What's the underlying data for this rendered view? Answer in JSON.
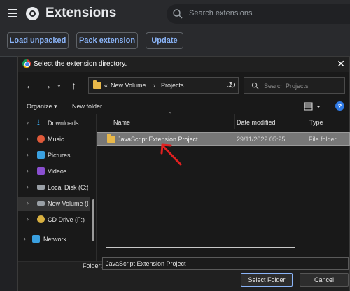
{
  "header": {
    "title": "Extensions",
    "search_placeholder": "Search extensions"
  },
  "toolbar": {
    "load_unpacked": "Load unpacked",
    "pack_extension": "Pack extension",
    "update": "Update"
  },
  "dialog": {
    "title": "Select the extension directory.",
    "close": "✕",
    "breadcrumb": {
      "prefix": "«",
      "parent": "New Volume ...",
      "separator": "›",
      "current": "Projects"
    },
    "search_placeholder": "Search Projects",
    "commands": {
      "organize": "Organize ▾",
      "new_folder": "New folder",
      "help": "?"
    },
    "nav_items": [
      {
        "label": "Downloads",
        "icon": "download-icon",
        "color": "#3aa0e0"
      },
      {
        "label": "Music",
        "icon": "music-icon",
        "color": "#e05a3a"
      },
      {
        "label": "Pictures",
        "icon": "pictures-icon",
        "color": "#3aa0e0"
      },
      {
        "label": "Videos",
        "icon": "videos-icon",
        "color": "#8a4fd0"
      },
      {
        "label": "Local Disk (C:)",
        "icon": "drive-icon",
        "color": "#9aa0a6"
      },
      {
        "label": "New Volume (D",
        "icon": "drive-icon",
        "color": "#9aa0a6"
      },
      {
        "label": "CD Drive (F:)",
        "icon": "cd-drive-icon",
        "color": "#d8b040"
      },
      {
        "label": "Network",
        "icon": "network-icon",
        "color": "#3aa0e0"
      }
    ],
    "columns": {
      "name": "Name",
      "date": "Date modified",
      "type": "Type"
    },
    "files": [
      {
        "name": "JavaScript Extension Project",
        "date": "29/11/2022 05:25",
        "type": "File folder"
      }
    ],
    "folder_label": "Folder:",
    "folder_value": "JavaScript Extension Project",
    "select_button": "Select Folder",
    "cancel_button": "Cancel"
  },
  "colors": {
    "accent": "#8ab4f8",
    "annotation_arrow": "#e02020"
  }
}
